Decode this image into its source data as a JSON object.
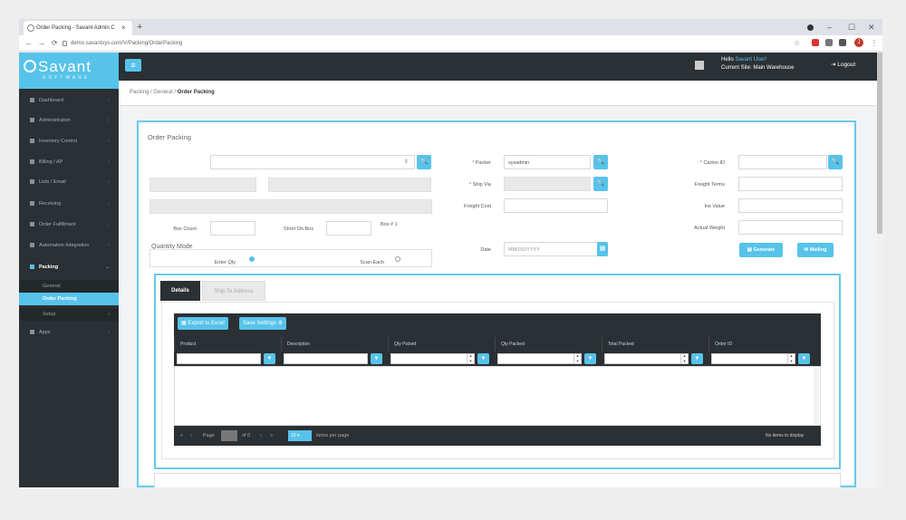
{
  "browser": {
    "tab_title": "Order Packing - Savant Admin C",
    "tab_close": "×",
    "new_tab": "+",
    "nav": {
      "back": "←",
      "forward": "→",
      "reload": "⟳"
    },
    "url": "demo.savantsys.com/V/Packing/OrderPacking",
    "win": {
      "min": "–",
      "max": "☐",
      "close": "✕"
    },
    "profile_initial": "J",
    "star": "☆"
  },
  "logo": {
    "name": "Savant",
    "tagline": "SOFTWARE"
  },
  "sidebar": {
    "items": [
      {
        "label": "Dashboard",
        "chev": "›"
      },
      {
        "label": "Administration",
        "chev": "›"
      },
      {
        "label": "Inventory Control",
        "chev": "›"
      },
      {
        "label": "Billing / AP",
        "chev": "›"
      },
      {
        "label": "Lists / Email",
        "chev": "›"
      },
      {
        "label": "Receiving",
        "chev": "›"
      },
      {
        "label": "Order Fulfillment",
        "chev": "›"
      },
      {
        "label": "Automation Integration",
        "chev": "›"
      },
      {
        "label": "Packing",
        "chev": "⌄"
      }
    ],
    "sub": [
      {
        "label": "General"
      },
      {
        "label": "Order Packing"
      },
      {
        "label": "Setup",
        "chev": "›"
      }
    ],
    "after": [
      {
        "label": "Apps",
        "chev": "›"
      }
    ]
  },
  "header": {
    "menu_glyph": "≡",
    "hello_prefix": "Hello ",
    "user": "Savant User!",
    "site": "Current Site: Main Warehouse",
    "logout": "Logout"
  },
  "breadcrumb": {
    "items": [
      "Packing",
      "General",
      "Order Packing"
    ],
    "sep": "/"
  },
  "form": {
    "title": "Order Packing",
    "search_glyph": "🔍",
    "packer_label": "Packer",
    "packer_value": "sysadmin",
    "carton_label": "Carton ID",
    "ship_via_label": "Ship Via",
    "freight_terms_label": "Freight Terms",
    "freight_cost_label": "Freight Cost",
    "ins_value_label": "Ins Value",
    "box_count_label": "Box Count",
    "short_on_box_label": "Short On Box",
    "box_no_label": "Box # 1",
    "actual_weight_label": "Actual Weight",
    "quantity_mode_label": "Quantity Mode",
    "enter_qty_label": "Enter Qty",
    "scan_each_label": "Scan Each",
    "date_label": "Date",
    "date_value": "MM/DD/YYYY",
    "generate_label": "Generate",
    "mailing_label": "Mailing",
    "required_mark": "*"
  },
  "details": {
    "tabs": [
      "Details",
      "Ship To Address"
    ],
    "export_label": "Export to Excel",
    "save_settings_label": "Save Settings",
    "columns": [
      "Product",
      "Description",
      "Qty Picked",
      "Qty Packed",
      "Total Packed",
      "Order ID"
    ],
    "pager": {
      "first": "«",
      "prev": "‹",
      "page_label": "Page",
      "of_label": "of 0",
      "next": "›",
      "last": "»",
      "per_page_value": "10",
      "per_page_label": "items per page"
    },
    "no_items": "No items to display",
    "filter_glyph": "▼",
    "spin_up": "▲",
    "spin_down": "▼"
  },
  "colors": {
    "accent": "#57c3ea",
    "dark": "#2b3034",
    "required": "#e04040"
  }
}
